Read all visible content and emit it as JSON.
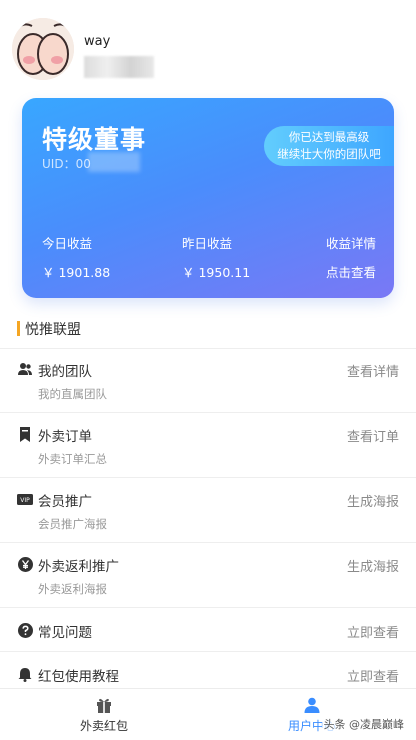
{
  "profile": {
    "username": "way"
  },
  "card": {
    "title": "特级董事",
    "uid_label": "UID：00",
    "badge_line1": "你已达到最高级",
    "badge_line2": "继续壮大你的团队吧",
    "today_label": "今日收益",
    "today_value": "￥ 1901.88",
    "yesterday_label": "昨日收益",
    "yesterday_value": "￥ 1950.11",
    "detail_label": "收益详情",
    "detail_action": "点击查看"
  },
  "section": {
    "title": "悦推联盟"
  },
  "menu": [
    {
      "title": "我的团队",
      "subtitle": "我的直属团队",
      "action": "查看详情",
      "icon": "team-icon"
    },
    {
      "title": "外卖订单",
      "subtitle": "外卖订单汇总",
      "action": "查看订单",
      "icon": "bookmark-icon"
    },
    {
      "title": "会员推广",
      "subtitle": "会员推广海报",
      "action": "生成海报",
      "icon": "vip-icon"
    },
    {
      "title": "外卖返利推广",
      "subtitle": "外卖返利海报",
      "action": "生成海报",
      "icon": "yen-icon"
    },
    {
      "title": "常见问题",
      "action": "立即查看",
      "icon": "question-icon"
    },
    {
      "title": "红包使用教程",
      "action": "立即查看",
      "icon": "bell-icon"
    }
  ],
  "tabbar": {
    "left_label": "外卖红包",
    "right_label": "用户中心",
    "active_color": "#3a8dff"
  },
  "watermark": "头条 @凌晨巅峰"
}
